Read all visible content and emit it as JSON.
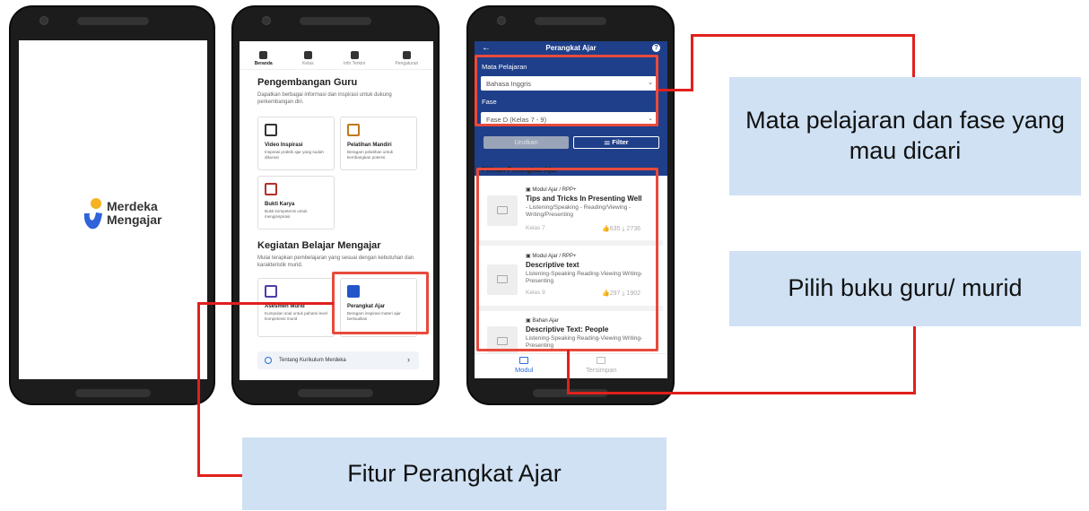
{
  "phone1": {
    "brand_line1": "Merdeka",
    "brand_line2": "Mengajar"
  },
  "phone2": {
    "nav": [
      {
        "label": "Beranda",
        "icon": "home-icon"
      },
      {
        "label": "Kelas",
        "icon": "class-icon"
      },
      {
        "label": "Info Terkini",
        "icon": "news-icon"
      },
      {
        "label": "Pengaturan",
        "icon": "gear-icon"
      }
    ],
    "section1_title": "Pengembangan Guru",
    "section1_desc": "Dapatkan berbagai informasi dan inspirasi untuk dukung perkembangan diri.",
    "cards1": [
      {
        "title": "Video Inspirasi",
        "desc": "Inspirasi praktik ajar yang sudah dikurasi"
      },
      {
        "title": "Pelatihan Mandiri",
        "desc": "Beragam pelatihan untuk kembangkan potensi"
      },
      {
        "title": "Bukti Karya",
        "desc": "Bukti kompetensi untuk menginspirasi"
      }
    ],
    "section2_title": "Kegiatan Belajar Mengajar",
    "section2_desc": "Mulai terapkan pembelajaran yang sesuai dengan kebutuhan dan karakteristik murid.",
    "cards2": [
      {
        "title": "Asesmen Murid",
        "desc": "Kumpulan soal untuk pahami level kompetensi murid"
      },
      {
        "title": "Perangkat Ajar",
        "desc": "Beragam inspirasi materi ajar berkualitas"
      }
    ],
    "kurikulum_label": "Tentang Kurikulum Merdeka"
  },
  "phone3": {
    "title": "Perangkat Ajar",
    "subject_label": "Mata Pelajaran",
    "subject_value": "Bahasa Inggris",
    "phase_label": "Fase",
    "phase_value": "Fase D (Kelas 7 - 9)",
    "sort_label": "Urutkan",
    "filter_label": "Filter",
    "list_title": "Pilihan Perangkat Ajar",
    "items": [
      {
        "type": "Modul Ajar / RPP+",
        "title": "Tips and Tricks In Presenting Well",
        "sub": "- Listening/Speaking - Reading/Viewing - Writing/Presenting",
        "kelas": "Kelas 7",
        "likes": "635",
        "downloads": "2736"
      },
      {
        "type": "Modul Ajar / RPP+",
        "title": "Descriptive text",
        "sub": "Listening-Speaking Reading-Viewing Writing-Presenting",
        "kelas": "Kelas 9",
        "likes": "297",
        "downloads": "1902"
      },
      {
        "type": "Bahan Ajar",
        "title": "Descriptive Text: People",
        "sub": "Listening-Speaking Reading-Viewing Writing-Presenting",
        "kelas": "",
        "likes": "",
        "downloads": ""
      }
    ],
    "bottom_nav": [
      {
        "label": "Modul"
      },
      {
        "label": "Tersimpan"
      }
    ]
  },
  "callouts": {
    "top": "Mata pelajaran dan fase yang mau dicari",
    "middle": "Pilih buku guru/ murid",
    "bottom": "Fitur Perangkat Ajar"
  },
  "colors": {
    "header_blue": "#1f3f8a",
    "callout_bg": "#cfe1f3",
    "highlight_red": "#e84a3c",
    "link_blue": "#2d6fd6"
  }
}
